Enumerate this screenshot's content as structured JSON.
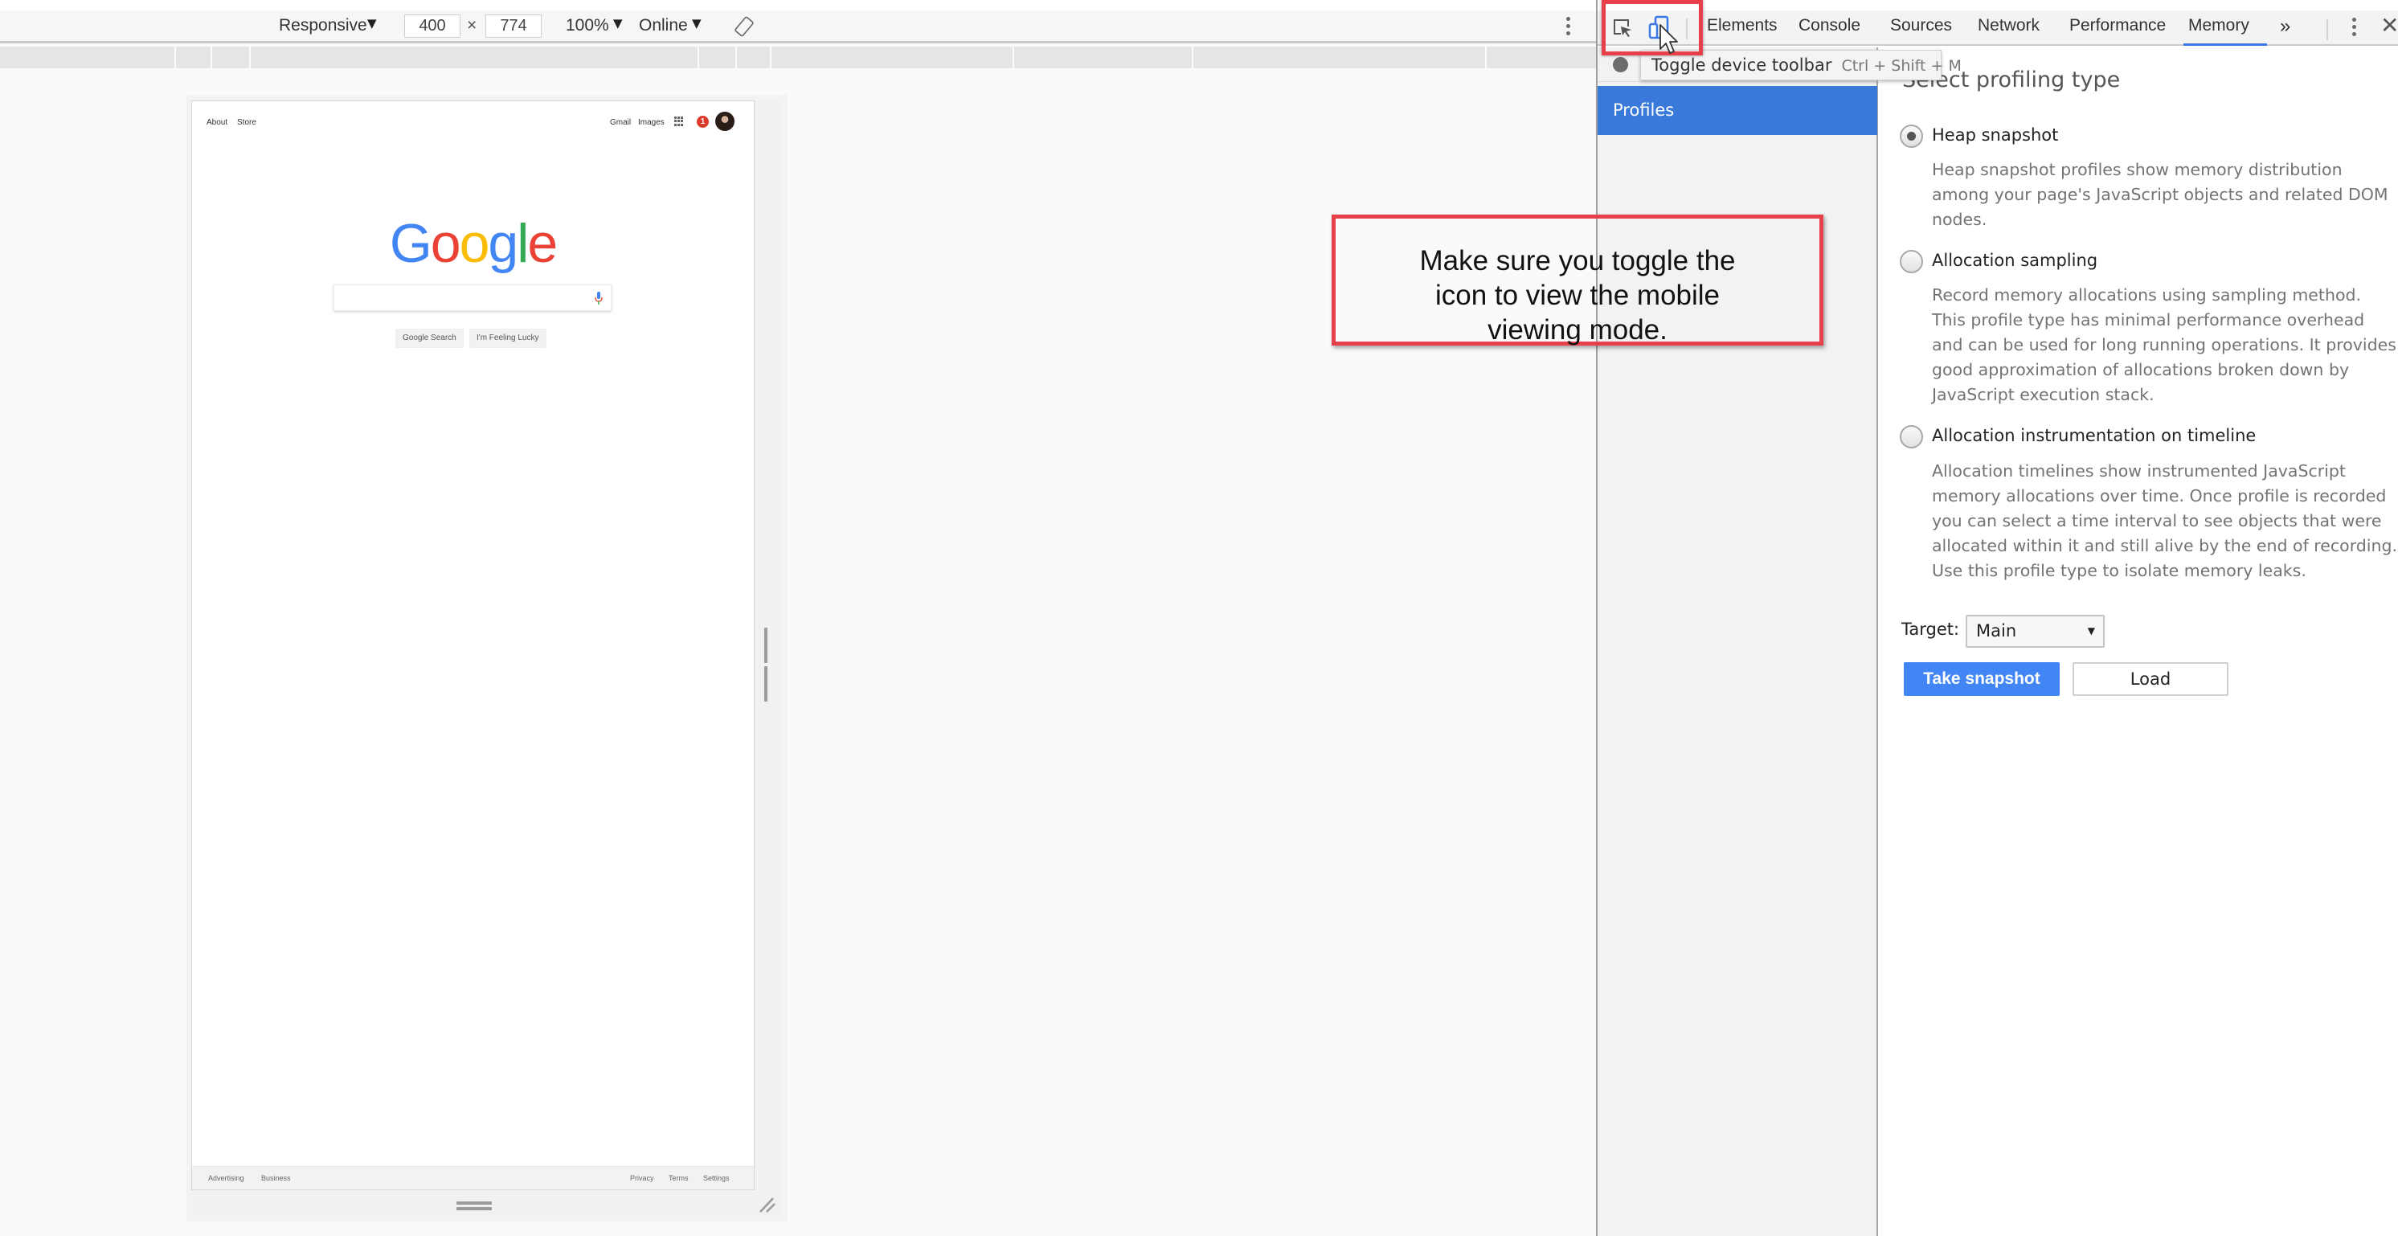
{
  "device_toolbar": {
    "device": "Responsive",
    "width": "400",
    "times": "×",
    "height": "774",
    "zoom": "100%",
    "network": "Online",
    "caret": "▼"
  },
  "emulated_page": {
    "top_left_links": [
      "About",
      "Store"
    ],
    "top_right_links": [
      "Gmail",
      "Images"
    ],
    "notification_count": "1",
    "logo_letters": [
      {
        "char": "G",
        "color": "#4285f4"
      },
      {
        "char": "o",
        "color": "#ea4335"
      },
      {
        "char": "o",
        "color": "#fbbc05"
      },
      {
        "char": "g",
        "color": "#4285f4"
      },
      {
        "char": "l",
        "color": "#34a853"
      },
      {
        "char": "e",
        "color": "#ea4335"
      }
    ],
    "search_value": "",
    "buttons": [
      "Google Search",
      "I'm Feeling Lucky"
    ],
    "footer_left": [
      "Advertising",
      "Business"
    ],
    "footer_right": [
      "Privacy",
      "Terms",
      "Settings"
    ]
  },
  "devtools": {
    "tabs": [
      "Elements",
      "Console",
      "Sources",
      "Network",
      "Performance",
      "Memory"
    ],
    "active_tab": "Memory",
    "overflow": "»",
    "close": "✕",
    "tooltip": {
      "label": "Toggle device toolbar",
      "shortcut": "Ctrl + Shift + M"
    },
    "sidebar": {
      "items": [
        "Profiles"
      ]
    },
    "memory": {
      "title": "Select profiling type",
      "options": [
        {
          "label": "Heap snapshot",
          "checked": true,
          "description": "Heap snapshot profiles show memory distribution among your page's JavaScript objects and related DOM nodes."
        },
        {
          "label": "Allocation sampling",
          "checked": false,
          "description": "Record memory allocations using sampling method. This profile type has minimal performance overhead and can be used for long running operations. It provides good approximation of allocations broken down by JavaScript execution stack."
        },
        {
          "label": "Allocation instrumentation on timeline",
          "checked": false,
          "description": "Allocation timelines show instrumented JavaScript memory allocations over time. Once profile is recorded you can select a time interval to see objects that were allocated within it and still alive by the end of recording. Use this profile type to isolate memory leaks."
        }
      ],
      "target_label": "Target:",
      "target_value": "Main",
      "take_snapshot_label": "Take snapshot",
      "load_label": "Load"
    },
    "accent_color": "#3879d9"
  },
  "annotation": {
    "callout_text": "Make sure you toggle the icon to view the mobile viewing mode.",
    "highlight_color": "#e8404a"
  }
}
